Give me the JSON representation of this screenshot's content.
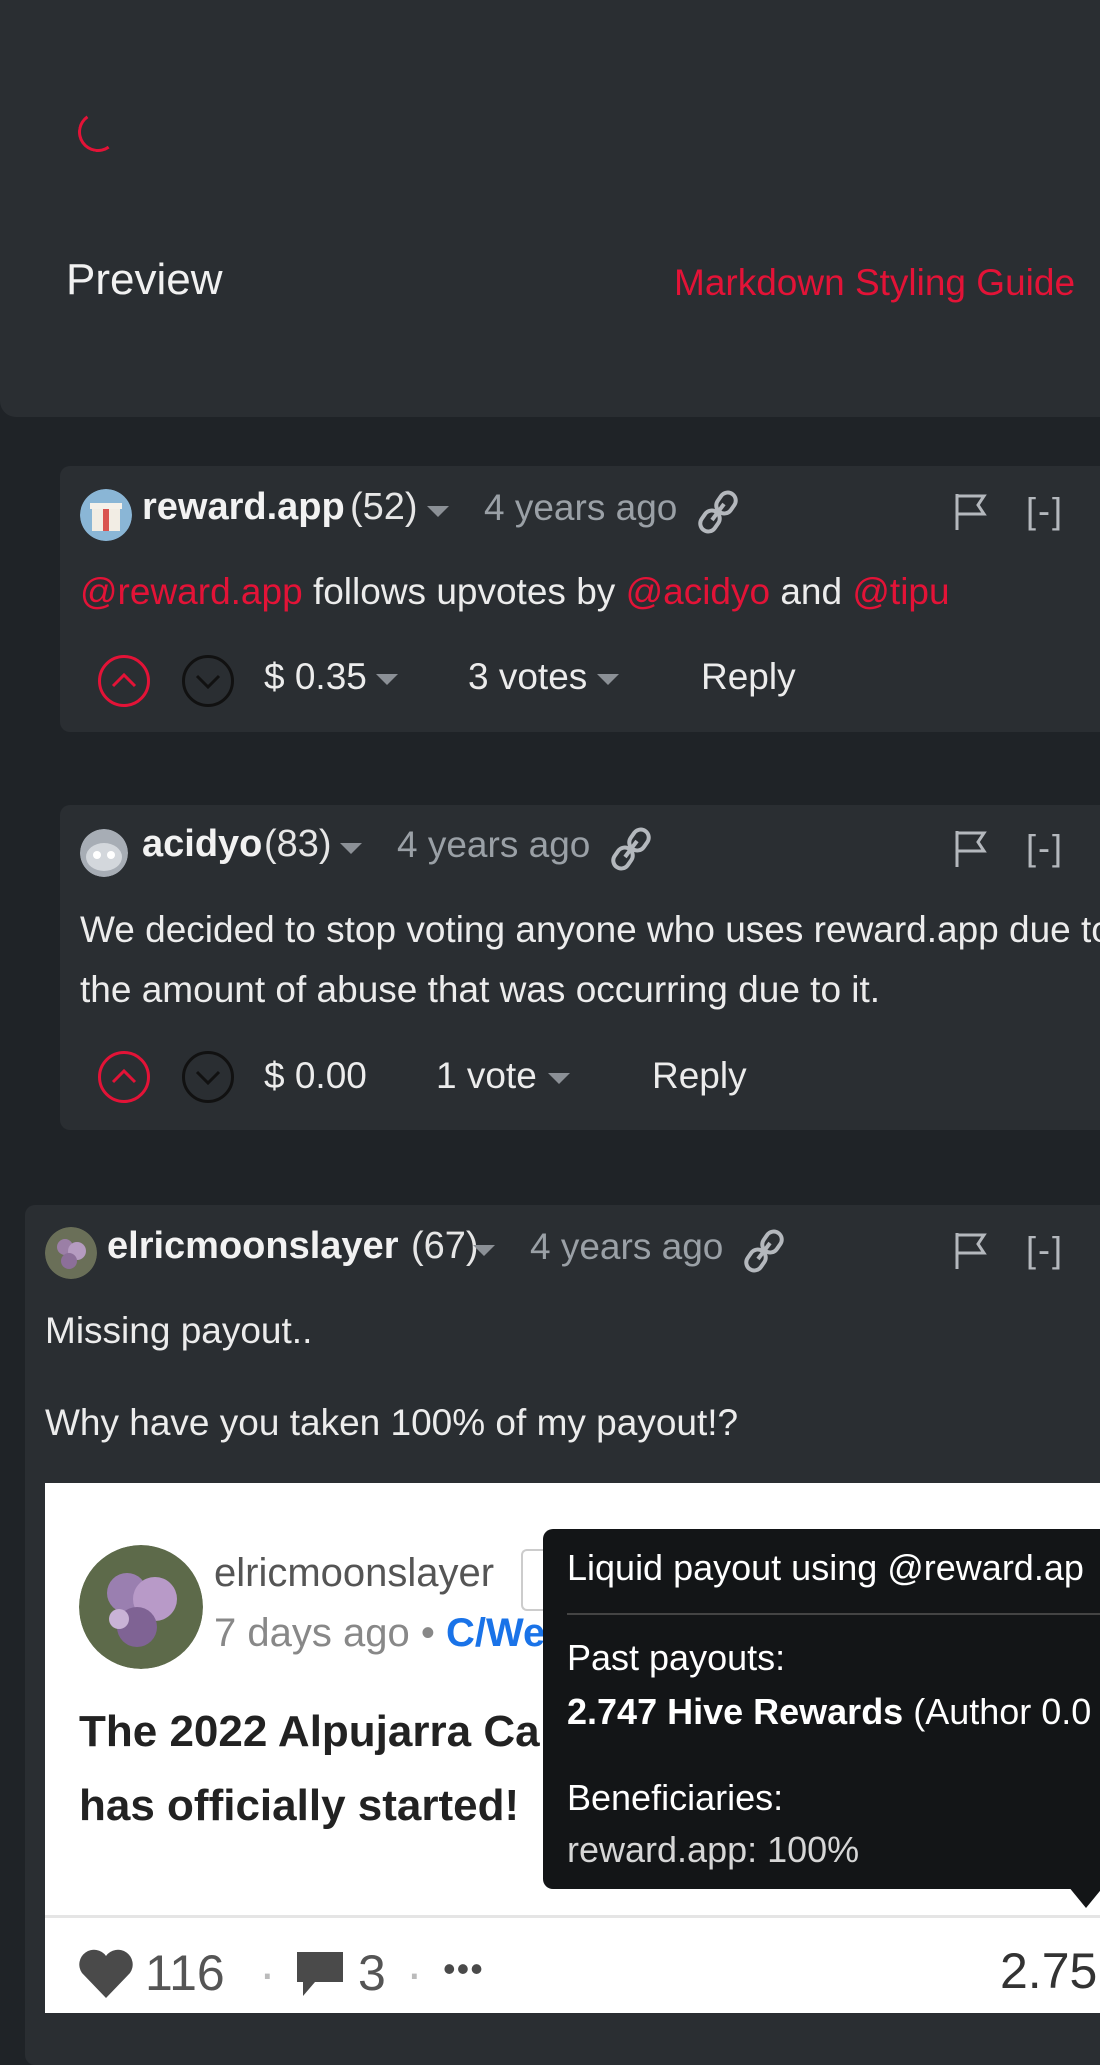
{
  "editor": {
    "preview_label": "Preview",
    "markdown_guide": "Markdown Styling Guide"
  },
  "comments": [
    {
      "author": "reward.app",
      "reputation": "(52)",
      "time": "4 years ago",
      "collapse": "[-]",
      "body_mention_1": "@reward.app",
      "body_text_1": " follows upvotes by ",
      "body_mention_2": "@acidyo",
      "body_text_2": " and ",
      "body_mention_3": "@tipu",
      "payout": "$ 0.35",
      "votes": "3 votes",
      "reply": "Reply"
    },
    {
      "author": "acidyo",
      "reputation": "(83)",
      "time": "4 years ago",
      "collapse": "[-]",
      "body": "We decided to stop voting anyone who uses reward.app due to the amount of abuse that was occurring due to it.",
      "payout": "$ 0.00",
      "votes": "1 vote",
      "reply": "Reply"
    },
    {
      "author": "elricmoonslayer",
      "reputation": "(67)",
      "time": "4 years ago",
      "collapse": "[-]",
      "body_line_1": "Missing payout..",
      "body_line_2": "Why have you taken 100% of my payout!?"
    }
  ],
  "embedded_card": {
    "author": "elricmoonslayer",
    "time": "7 days ago",
    "separator": "•",
    "community": "C/We",
    "title": "The 2022 Alpujarra Ca has officially started!",
    "likes": "116",
    "comments": "3",
    "dot": "·",
    "more": "•••",
    "payout": "2.75",
    "tooltip": {
      "header": "Liquid payout using @reward.ap",
      "past_label": "Past payouts:",
      "past_value_bold": "2.747 Hive Rewards",
      "past_value_rest": " (Author 0.0",
      "beneficiaries_label": "Beneficiaries:",
      "beneficiaries_value": "reward.app: 100%"
    }
  },
  "icons": [
    "link-icon",
    "flag-icon",
    "chevron-up-icon",
    "chevron-down-icon",
    "heart-icon",
    "comment-icon",
    "more-icon"
  ],
  "colors": {
    "accent": "#e31337",
    "background": "#1f2327",
    "panel": "#2a2e32",
    "link": "#1a73e8"
  }
}
